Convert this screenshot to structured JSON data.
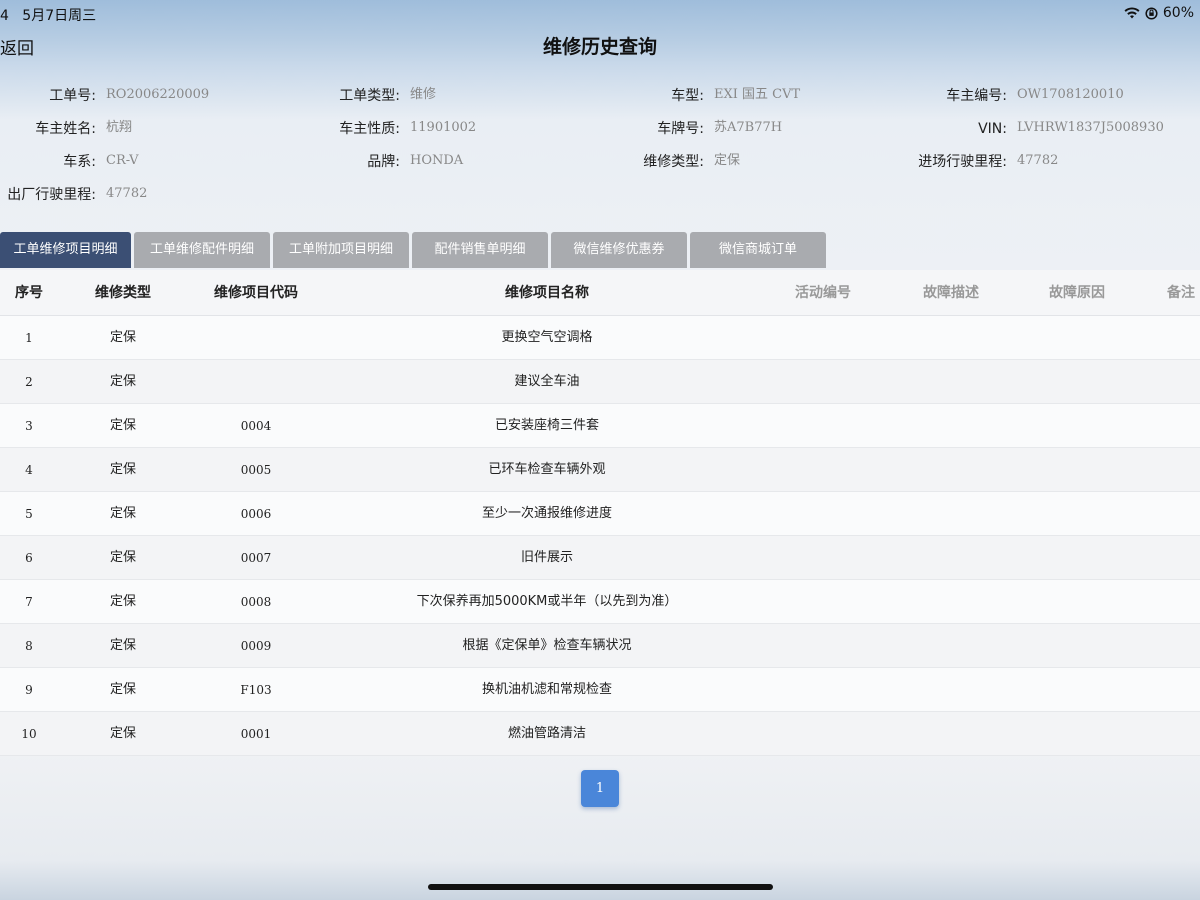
{
  "status_bar": {
    "time": "4",
    "date": "5月7日周三",
    "battery": "60%"
  },
  "nav": {
    "back_label": "返回",
    "title": "维修历史查询"
  },
  "info": {
    "order_no": {
      "label": "工单号:",
      "value": "RO2006220009"
    },
    "order_type": {
      "label": "工单类型:",
      "value": "维修"
    },
    "car_model": {
      "label": "车型:",
      "value": "EXI 国五 CVT"
    },
    "owner_no": {
      "label": "车主编号:",
      "value": "OW1708120010"
    },
    "owner_name": {
      "label": "车主姓名:",
      "value": "杭翔"
    },
    "owner_nature": {
      "label": "车主性质:",
      "value": "11901002"
    },
    "plate_no": {
      "label": "车牌号:",
      "value": "苏A7B77H"
    },
    "vin": {
      "label": "VIN:",
      "value": "LVHRW1837J5008930"
    },
    "series": {
      "label": "车系:",
      "value": "CR-V"
    },
    "brand": {
      "label": "品牌:",
      "value": "HONDA"
    },
    "repair_type": {
      "label": "维修类型:",
      "value": "定保"
    },
    "in_mileage": {
      "label": "进场行驶里程:",
      "value": "47782"
    },
    "out_mileage": {
      "label": "出厂行驶里程:",
      "value": "47782"
    }
  },
  "tabs": [
    "工单维修项目明细",
    "工单维修配件明细",
    "工单附加项目明细",
    "配件销售单明细",
    "微信维修优惠券",
    "微信商城订单"
  ],
  "table": {
    "headers": [
      "序号",
      "维修类型",
      "维修项目代码",
      "维修项目名称",
      "活动编号",
      "故障描述",
      "故障原因",
      "备注"
    ],
    "rows": [
      {
        "no": "1",
        "type": "定保",
        "code": "",
        "name": "更换空气空调格"
      },
      {
        "no": "2",
        "type": "定保",
        "code": "",
        "name": "建议全车油"
      },
      {
        "no": "3",
        "type": "定保",
        "code": "0004",
        "name": "已安装座椅三件套"
      },
      {
        "no": "4",
        "type": "定保",
        "code": "0005",
        "name": "已环车检查车辆外观"
      },
      {
        "no": "5",
        "type": "定保",
        "code": "0006",
        "name": "至少一次通报维修进度"
      },
      {
        "no": "6",
        "type": "定保",
        "code": "0007",
        "name": "旧件展示"
      },
      {
        "no": "7",
        "type": "定保",
        "code": "0008",
        "name": "下次保养再加5000KM或半年（以先到为准）"
      },
      {
        "no": "8",
        "type": "定保",
        "code": "0009",
        "name": "根据《定保单》检查车辆状况"
      },
      {
        "no": "9",
        "type": "定保",
        "code": "F103",
        "name": "换机油机滤和常规检查"
      },
      {
        "no": "10",
        "type": "定保",
        "code": "0001",
        "name": "燃油管路清洁"
      }
    ]
  },
  "pagination": {
    "current": "1"
  }
}
